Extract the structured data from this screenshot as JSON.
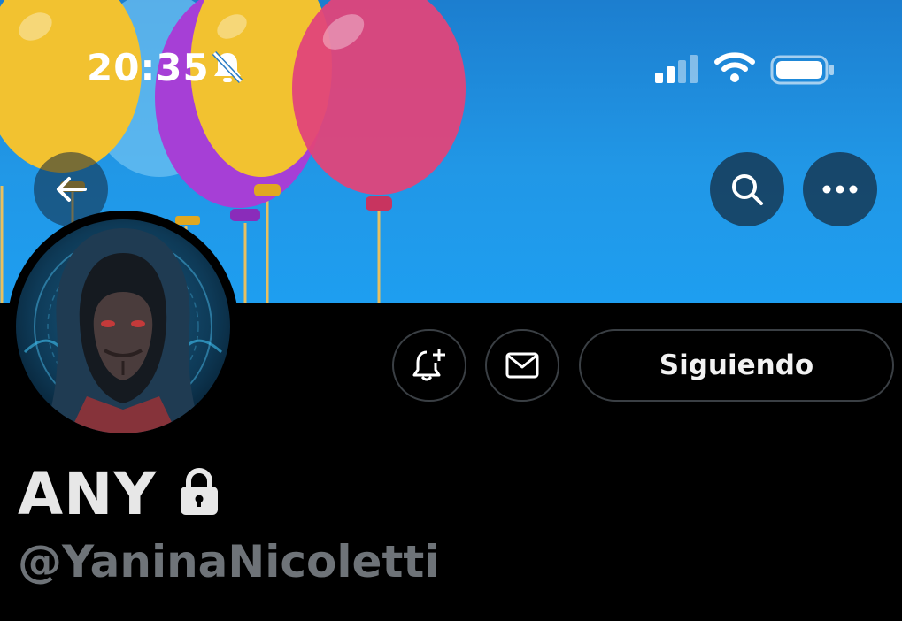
{
  "status_bar": {
    "time": "20:35",
    "icons": [
      "bell-slash-icon",
      "cellular-signal-icon",
      "wifi-icon",
      "battery-icon"
    ]
  },
  "header": {
    "icons": [
      "back-arrow-icon",
      "search-icon",
      "more-icon"
    ]
  },
  "banner": {
    "colors": {
      "sky": "#2197e6",
      "yellow": "#f2c230",
      "purple": "#a63fd6",
      "pink": "#e0457a",
      "light_blue": "#5bb6ee"
    }
  },
  "profile": {
    "display_name": "ANY",
    "handle": "@YaninaNicoletti",
    "protected_icon": "lock-icon",
    "follow_button_label": "Siguiendo",
    "action_icons": [
      "bell-plus-icon",
      "envelope-icon"
    ]
  },
  "colors": {
    "background": "#000000",
    "name": "#e7e7e7",
    "handle": "#6e7378",
    "button_border": "#3a3f44"
  }
}
